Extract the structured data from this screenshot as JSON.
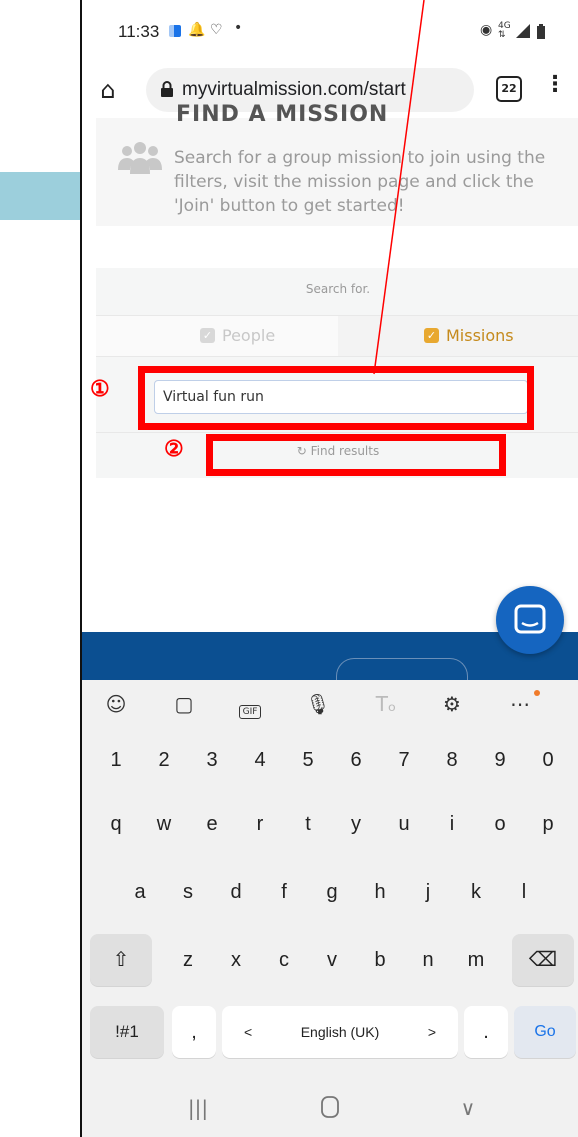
{
  "status_bar": {
    "time": "11:33",
    "left_icons": [
      "calendar-icon",
      "bell-icon",
      "heart-icon",
      "dot-icon"
    ],
    "right_icons": [
      "location-icon",
      "4g-icon",
      "signal-icon",
      "battery-icon"
    ]
  },
  "browser": {
    "url": "myvirtualmission.com/start",
    "tab_count": "22"
  },
  "find_card": {
    "title": "FIND A MISSION",
    "description": "Search for a group mission to join using the filters, visit the mission page and click the 'Join' button to get started!"
  },
  "search": {
    "heading": "Search for.",
    "options": [
      {
        "label": "People",
        "checked": true,
        "active": false
      },
      {
        "label": "Missions",
        "checked": true,
        "active": true
      }
    ],
    "input_value": "Virtual fun run",
    "button_label": "Find results"
  },
  "annotations": [
    {
      "number": "①"
    },
    {
      "number": "②"
    }
  ],
  "keyboard": {
    "toolbar": [
      "smiley-icon",
      "sticker-icon",
      "gif-icon",
      "microphone-icon",
      "handwriting-icon",
      "settings-icon",
      "more-icon"
    ],
    "gif_label": "GIF",
    "rows": [
      [
        "1",
        "2",
        "3",
        "4",
        "5",
        "6",
        "7",
        "8",
        "9",
        "0"
      ],
      [
        "q",
        "w",
        "e",
        "r",
        "t",
        "y",
        "u",
        "i",
        "o",
        "p"
      ],
      [
        "a",
        "s",
        "d",
        "f",
        "g",
        "h",
        "j",
        "k",
        "l"
      ],
      [
        "⇧",
        "z",
        "x",
        "c",
        "v",
        "b",
        "n",
        "m",
        "⌫"
      ]
    ],
    "bottom_row": {
      "symbols": "!#1",
      "comma": ",",
      "left": "<",
      "space": "English (UK)",
      "right": ">",
      "period": ".",
      "go": "Go"
    }
  },
  "nav_bar": [
    "recents-icon",
    "home-icon",
    "back-icon"
  ],
  "colors": {
    "accent_blue": "#0b4f91",
    "annotation_red": "#ff0000",
    "arrow_blue": "#9ccfdc",
    "missions_orange": "#e8a830"
  }
}
